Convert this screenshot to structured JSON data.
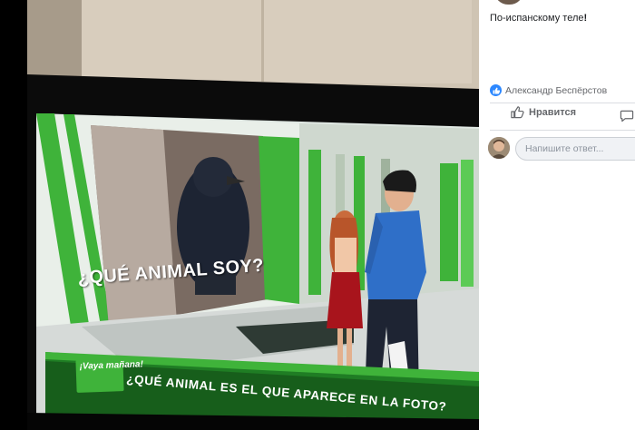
{
  "post": {
    "text": "По-испанскому теле",
    "text_bold_suffix": "!",
    "reactions": {
      "type": "like-icon",
      "name": "Александр Беспёрстов",
      "color": "#2d88ff"
    }
  },
  "actions": {
    "like_label": "Нравится"
  },
  "comment": {
    "placeholder": "Напишите ответ..."
  },
  "photo": {
    "onscreen_question": "¿QUÉ ANIMAL SOY?",
    "show_logo": "¡Vaya mañana!",
    "ticker": "¿QUÉ ANIMAL ES EL QUE APARECE EN LA FOTO?",
    "accent_color": "#3fb33a"
  }
}
